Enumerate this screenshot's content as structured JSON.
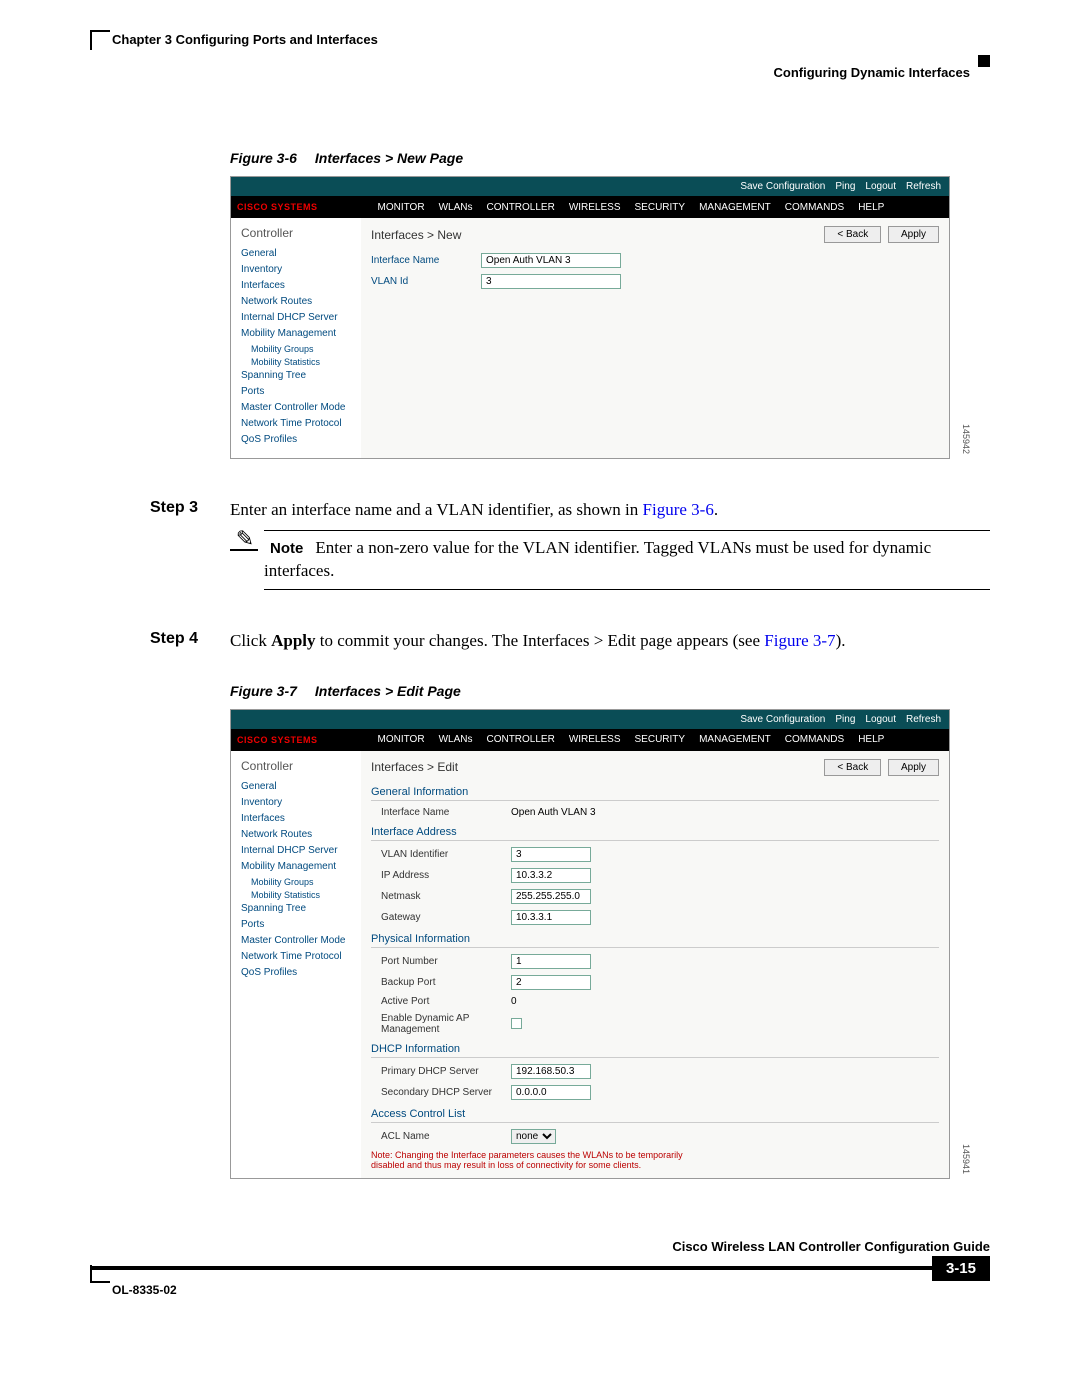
{
  "header": {
    "chapter_line": "Chapter 3    Configuring Ports and Interfaces",
    "section_line": "Configuring Dynamic Interfaces"
  },
  "figure1": {
    "caption_num": "Figure 3-6",
    "caption_title": "Interfaces > New Page",
    "side_num": "145942"
  },
  "figure2": {
    "caption_num": "Figure 3-7",
    "caption_title": "Interfaces > Edit Page",
    "side_num": "145941"
  },
  "cisco_ui": {
    "logo": "CISCO SYSTEMS",
    "toplinks": [
      "Save Configuration",
      "Ping",
      "Logout",
      "Refresh"
    ],
    "menus": [
      "MONITOR",
      "WLANs",
      "CONTROLLER",
      "WIRELESS",
      "SECURITY",
      "MANAGEMENT",
      "COMMANDS",
      "HELP"
    ],
    "sidebar_title": "Controller",
    "sidebar": [
      "General",
      "Inventory",
      "Interfaces",
      "Network Routes",
      "Internal DHCP Server"
    ],
    "sidebar_mob": "Mobility Management",
    "sidebar_mob_sub": [
      "Mobility Groups",
      "Mobility Statistics"
    ],
    "sidebar2": [
      "Spanning Tree",
      "Ports",
      "Master Controller Mode",
      "Network Time Protocol",
      "QoS Profiles"
    ],
    "buttons": {
      "back": "< Back",
      "apply": "Apply"
    }
  },
  "fig1_main": {
    "breadcrumb": "Interfaces > New",
    "rows": {
      "iface_name_label": "Interface Name",
      "iface_name_value": "Open Auth VLAN 3",
      "vlan_label": "VLAN Id",
      "vlan_value": "3"
    }
  },
  "fig2_main": {
    "breadcrumb": "Interfaces > Edit",
    "sec_general": "General Information",
    "iface_name_label": "Interface Name",
    "iface_name_value": "Open Auth VLAN 3",
    "sec_addr": "Interface Address",
    "vlan_label": "VLAN Identifier",
    "vlan_value": "3",
    "ip_label": "IP Address",
    "ip_value": "10.3.3.2",
    "mask_label": "Netmask",
    "mask_value": "255.255.255.0",
    "gw_label": "Gateway",
    "gw_value": "10.3.3.1",
    "sec_phys": "Physical Information",
    "port_label": "Port Number",
    "port_value": "1",
    "backup_label": "Backup Port",
    "backup_value": "2",
    "active_label": "Active Port",
    "active_value": "0",
    "dynap_label": "Enable Dynamic AP Management",
    "sec_dhcp": "DHCP Information",
    "dhcp1_label": "Primary DHCP Server",
    "dhcp1_value": "192.168.50.3",
    "dhcp2_label": "Secondary DHCP Server",
    "dhcp2_value": "0.0.0.0",
    "sec_acl": "Access Control List",
    "acl_label": "ACL Name",
    "acl_value": "none",
    "warn": "Note: Changing the Interface parameters causes the WLANs to be temporarily disabled and thus may result in loss of connectivity for some clients."
  },
  "steps": {
    "s3_label": "Step 3",
    "s3_text_a": "Enter an interface name and a VLAN identifier, as shown in ",
    "s3_link": "Figure 3-6",
    "s3_text_b": ".",
    "note_label": "Note",
    "note_text": "Enter a non-zero value for the VLAN identifier. Tagged VLANs must be used for dynamic interfaces.",
    "s4_label": "Step 4",
    "s4_text_a": "Click ",
    "s4_bold": "Apply",
    "s4_text_b": " to commit your changes. The Interfaces > Edit page appears (see ",
    "s4_link": "Figure 3-7",
    "s4_text_c": ")."
  },
  "footer": {
    "guide": "Cisco Wireless LAN Controller Configuration Guide",
    "doc": "OL-8335-02",
    "page": "3-15"
  }
}
